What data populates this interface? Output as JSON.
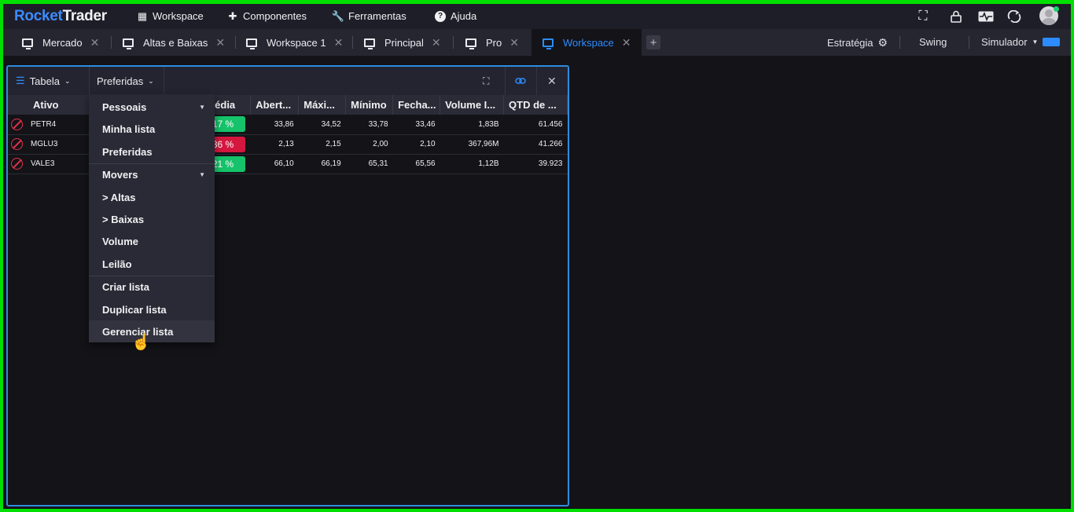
{
  "app": {
    "logo_part1": "Rocket",
    "logo_part2": "Trader"
  },
  "menu": [
    {
      "label": "Workspace",
      "icon": "grid-icon"
    },
    {
      "label": "Componentes",
      "icon": "puzzle-icon"
    },
    {
      "label": "Ferramentas",
      "icon": "wrench-icon"
    },
    {
      "label": "Ajuda",
      "icon": "help-icon"
    }
  ],
  "tabs": [
    {
      "label": "Mercado"
    },
    {
      "label": "Altas e Baixas"
    },
    {
      "label": "Workspace 1"
    },
    {
      "label": "Principal"
    },
    {
      "label": "Pro"
    },
    {
      "label": "Workspace"
    }
  ],
  "right_bar": {
    "estrategia": "Estratégia",
    "swing": "Swing",
    "simulador": "Simulador"
  },
  "panel": {
    "table_btn": "Tabela",
    "list_btn": "Preferidas",
    "columns": [
      "Ativo",
      "Média",
      "Abert...",
      "Máxi...",
      "Mínimo",
      "Fecha...",
      "Volume I...",
      "QTD de ..."
    ],
    "rows": [
      {
        "ativo": "PETR4",
        "var": "17 %",
        "dir": "up",
        "abertura": "33,86",
        "maxima": "34,52",
        "minimo": "33,78",
        "fechamento": "33,46",
        "volume": "1,83B",
        "qtd": "61.456"
      },
      {
        "ativo": "MGLU3",
        "var": "86 %",
        "dir": "dn",
        "abertura": "2,13",
        "maxima": "2,15",
        "minimo": "2,00",
        "fechamento": "2,10",
        "volume": "367,96M",
        "qtd": "41.266"
      },
      {
        "ativo": "VALE3",
        "var": "21 %",
        "dir": "up",
        "abertura": "66,10",
        "maxima": "66,19",
        "minimo": "65,31",
        "fechamento": "65,56",
        "volume": "1,12B",
        "qtd": "39.923"
      }
    ]
  },
  "dropdown": {
    "group1_title": "Pessoais",
    "group1": [
      "Minha lista",
      "Preferidas"
    ],
    "group2_title": "Movers",
    "group2": [
      "> Altas",
      "> Baixas",
      "Volume",
      "Leilão"
    ],
    "actions": [
      "Criar lista",
      "Duplicar lista",
      "Gerenciar lista"
    ]
  }
}
